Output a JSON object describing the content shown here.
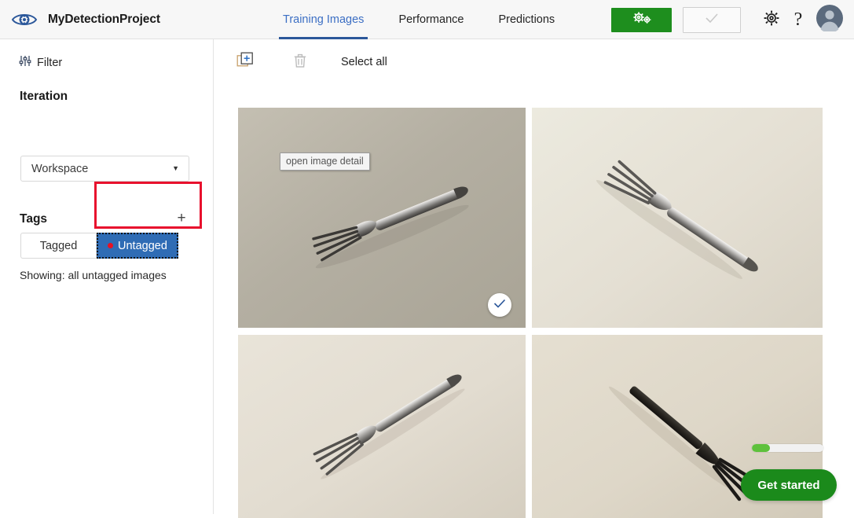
{
  "header": {
    "logo_icon": "eye-gear-icon",
    "project_title": "MyDetectionProject",
    "tabs": [
      {
        "label": "Training Images",
        "active": true
      },
      {
        "label": "Performance",
        "active": false
      },
      {
        "label": "Predictions",
        "active": false
      }
    ],
    "train_button": {
      "label": "",
      "icon": "gears-icon",
      "color": "#1e8e1e"
    },
    "quick_test_button": {
      "label": "",
      "icon": "checkmark-icon",
      "disabled": true
    },
    "settings_icon": "gear-icon",
    "help_icon": "question-mark-icon",
    "help_glyph": "?",
    "avatar": "user-avatar-icon"
  },
  "sidebar": {
    "filter": {
      "label": "Filter",
      "icon": "sliders-icon"
    },
    "iteration": {
      "title": "Iteration",
      "dropdown_value": "Workspace",
      "caret": "▼"
    },
    "tags": {
      "title": "Tags",
      "add_label": "+",
      "toggle": [
        {
          "label": "Tagged",
          "selected": false
        },
        {
          "label": "Untagged",
          "selected": true
        }
      ],
      "showing": "Showing: all untagged images"
    }
  },
  "toolbar": {
    "add_images_icon": "add-images-icon",
    "delete_icon": "trash-icon",
    "select_all_label": "Select all"
  },
  "grid": {
    "tooltip": "open image detail",
    "images": [
      {
        "name": "silver-fork-diagonal",
        "bg": "#b2aea2",
        "selected": true
      },
      {
        "name": "silver-fork-tines-left",
        "bg": "#e6e1d7",
        "selected": false
      },
      {
        "name": "silver-fork-tines-lower-left",
        "bg": "#e3ded3",
        "selected": false
      },
      {
        "name": "black-plastic-fork",
        "bg": "#dcd6c8",
        "selected": false
      }
    ]
  },
  "overlay": {
    "progress_percent": 25,
    "get_started_label": "Get started",
    "accent_green": "#1b8a1b",
    "progress_green": "#5ec13c"
  },
  "annotation": {
    "highlight_color": "#e8112d",
    "target": "untagged-tag-button"
  }
}
